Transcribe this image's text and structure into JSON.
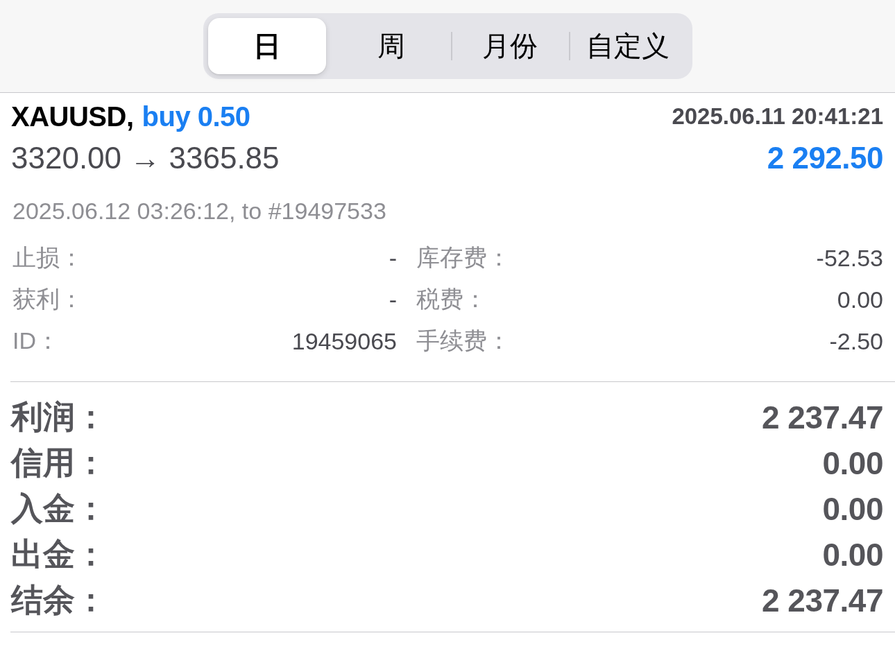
{
  "tabs": [
    {
      "label": "日",
      "selected": true
    },
    {
      "label": "周",
      "selected": false
    },
    {
      "label": "月份",
      "selected": false
    },
    {
      "label": "自定义",
      "selected": false
    }
  ],
  "trade": {
    "symbol": "XAUUSD,",
    "order": "buy 0.50",
    "open_time": "2025.06.11 20:41:21",
    "prices": "3320.00 → 3365.85",
    "profit": "2 292.50",
    "close_info": "2025.06.12 03:26:12, to #19497533"
  },
  "details": {
    "rows": [
      {
        "cells": [
          "止损：",
          "-",
          "库存费：",
          "-52.53"
        ]
      },
      {
        "cells": [
          "获利：",
          "-",
          "税费：",
          "0.00"
        ]
      },
      {
        "cells": [
          "ID：",
          "19459065",
          "手续费：",
          "-2.50"
        ]
      }
    ]
  },
  "summary": [
    {
      "label": "利润：",
      "value": "2 237.47"
    },
    {
      "label": "信用：",
      "value": "0.00"
    },
    {
      "label": "入金：",
      "value": "0.00"
    },
    {
      "label": "出金：",
      "value": "0.00"
    },
    {
      "label": "结余：",
      "value": "2 237.47"
    }
  ]
}
